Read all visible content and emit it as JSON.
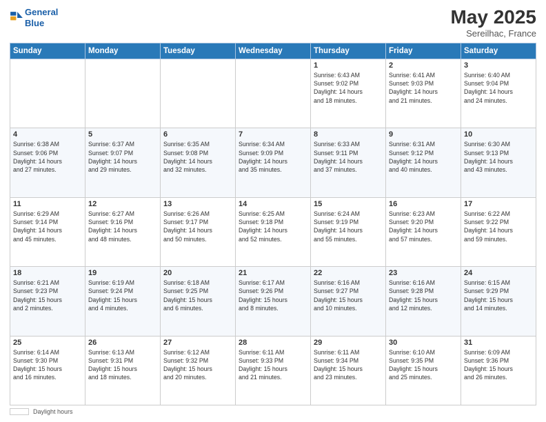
{
  "header": {
    "logo_line1": "General",
    "logo_line2": "Blue",
    "month": "May 2025",
    "location": "Sereilhac, France"
  },
  "days_of_week": [
    "Sunday",
    "Monday",
    "Tuesday",
    "Wednesday",
    "Thursday",
    "Friday",
    "Saturday"
  ],
  "weeks": [
    [
      {
        "day": "",
        "info": ""
      },
      {
        "day": "",
        "info": ""
      },
      {
        "day": "",
        "info": ""
      },
      {
        "day": "",
        "info": ""
      },
      {
        "day": "1",
        "info": "Sunrise: 6:43 AM\nSunset: 9:02 PM\nDaylight: 14 hours\nand 18 minutes."
      },
      {
        "day": "2",
        "info": "Sunrise: 6:41 AM\nSunset: 9:03 PM\nDaylight: 14 hours\nand 21 minutes."
      },
      {
        "day": "3",
        "info": "Sunrise: 6:40 AM\nSunset: 9:04 PM\nDaylight: 14 hours\nand 24 minutes."
      }
    ],
    [
      {
        "day": "4",
        "info": "Sunrise: 6:38 AM\nSunset: 9:06 PM\nDaylight: 14 hours\nand 27 minutes."
      },
      {
        "day": "5",
        "info": "Sunrise: 6:37 AM\nSunset: 9:07 PM\nDaylight: 14 hours\nand 29 minutes."
      },
      {
        "day": "6",
        "info": "Sunrise: 6:35 AM\nSunset: 9:08 PM\nDaylight: 14 hours\nand 32 minutes."
      },
      {
        "day": "7",
        "info": "Sunrise: 6:34 AM\nSunset: 9:09 PM\nDaylight: 14 hours\nand 35 minutes."
      },
      {
        "day": "8",
        "info": "Sunrise: 6:33 AM\nSunset: 9:11 PM\nDaylight: 14 hours\nand 37 minutes."
      },
      {
        "day": "9",
        "info": "Sunrise: 6:31 AM\nSunset: 9:12 PM\nDaylight: 14 hours\nand 40 minutes."
      },
      {
        "day": "10",
        "info": "Sunrise: 6:30 AM\nSunset: 9:13 PM\nDaylight: 14 hours\nand 43 minutes."
      }
    ],
    [
      {
        "day": "11",
        "info": "Sunrise: 6:29 AM\nSunset: 9:14 PM\nDaylight: 14 hours\nand 45 minutes."
      },
      {
        "day": "12",
        "info": "Sunrise: 6:27 AM\nSunset: 9:16 PM\nDaylight: 14 hours\nand 48 minutes."
      },
      {
        "day": "13",
        "info": "Sunrise: 6:26 AM\nSunset: 9:17 PM\nDaylight: 14 hours\nand 50 minutes."
      },
      {
        "day": "14",
        "info": "Sunrise: 6:25 AM\nSunset: 9:18 PM\nDaylight: 14 hours\nand 52 minutes."
      },
      {
        "day": "15",
        "info": "Sunrise: 6:24 AM\nSunset: 9:19 PM\nDaylight: 14 hours\nand 55 minutes."
      },
      {
        "day": "16",
        "info": "Sunrise: 6:23 AM\nSunset: 9:20 PM\nDaylight: 14 hours\nand 57 minutes."
      },
      {
        "day": "17",
        "info": "Sunrise: 6:22 AM\nSunset: 9:22 PM\nDaylight: 14 hours\nand 59 minutes."
      }
    ],
    [
      {
        "day": "18",
        "info": "Sunrise: 6:21 AM\nSunset: 9:23 PM\nDaylight: 15 hours\nand 2 minutes."
      },
      {
        "day": "19",
        "info": "Sunrise: 6:19 AM\nSunset: 9:24 PM\nDaylight: 15 hours\nand 4 minutes."
      },
      {
        "day": "20",
        "info": "Sunrise: 6:18 AM\nSunset: 9:25 PM\nDaylight: 15 hours\nand 6 minutes."
      },
      {
        "day": "21",
        "info": "Sunrise: 6:17 AM\nSunset: 9:26 PM\nDaylight: 15 hours\nand 8 minutes."
      },
      {
        "day": "22",
        "info": "Sunrise: 6:16 AM\nSunset: 9:27 PM\nDaylight: 15 hours\nand 10 minutes."
      },
      {
        "day": "23",
        "info": "Sunrise: 6:16 AM\nSunset: 9:28 PM\nDaylight: 15 hours\nand 12 minutes."
      },
      {
        "day": "24",
        "info": "Sunrise: 6:15 AM\nSunset: 9:29 PM\nDaylight: 15 hours\nand 14 minutes."
      }
    ],
    [
      {
        "day": "25",
        "info": "Sunrise: 6:14 AM\nSunset: 9:30 PM\nDaylight: 15 hours\nand 16 minutes."
      },
      {
        "day": "26",
        "info": "Sunrise: 6:13 AM\nSunset: 9:31 PM\nDaylight: 15 hours\nand 18 minutes."
      },
      {
        "day": "27",
        "info": "Sunrise: 6:12 AM\nSunset: 9:32 PM\nDaylight: 15 hours\nand 20 minutes."
      },
      {
        "day": "28",
        "info": "Sunrise: 6:11 AM\nSunset: 9:33 PM\nDaylight: 15 hours\nand 21 minutes."
      },
      {
        "day": "29",
        "info": "Sunrise: 6:11 AM\nSunset: 9:34 PM\nDaylight: 15 hours\nand 23 minutes."
      },
      {
        "day": "30",
        "info": "Sunrise: 6:10 AM\nSunset: 9:35 PM\nDaylight: 15 hours\nand 25 minutes."
      },
      {
        "day": "31",
        "info": "Sunrise: 6:09 AM\nSunset: 9:36 PM\nDaylight: 15 hours\nand 26 minutes."
      }
    ]
  ],
  "footer": {
    "note_label": "Daylight hours"
  }
}
